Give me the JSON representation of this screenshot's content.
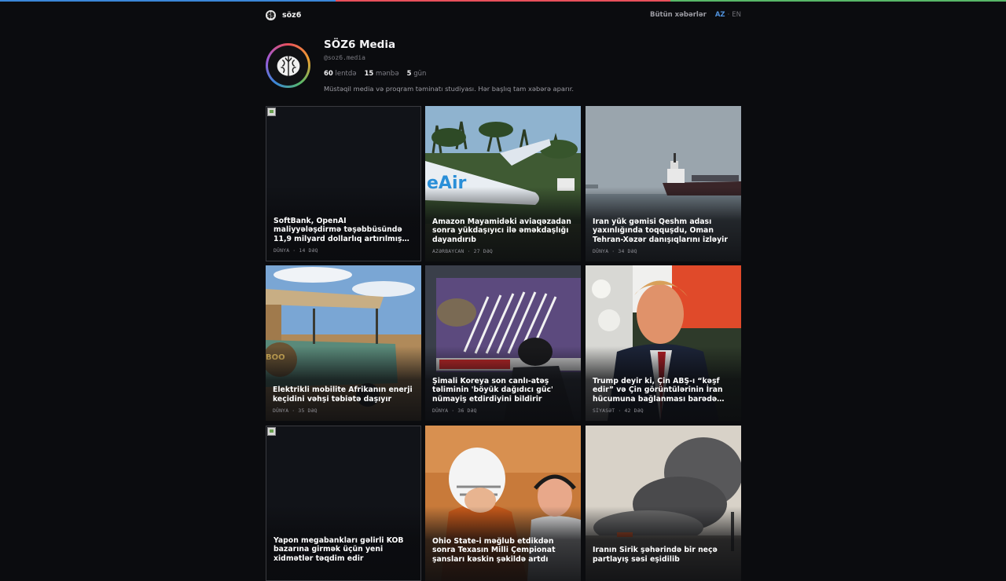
{
  "colors": {
    "top_line": [
      "#3a86d8",
      "#e8505b",
      "#58b868"
    ],
    "lang_active": "#4f8fd8"
  },
  "nav": {
    "brand": "söz6",
    "all_news": "Bütün xəbərlər",
    "lang_az": "AZ",
    "lang_sep": "·",
    "lang_en": "EN"
  },
  "profile": {
    "name": "SÖZ6 Media",
    "handle": "@soz6.media",
    "stats": [
      {
        "value": "60",
        "label": "lentdə"
      },
      {
        "value": "15",
        "label": "mənbə"
      },
      {
        "value": "5",
        "label": "gün"
      }
    ],
    "description": "Müstəqil media və proqram təminatı studiyası. Hər başlıq tam xəbərə aparır."
  },
  "cards": [
    {
      "title": "SoftBank, OpenAI maliyyələşdirmə təşəbbüsündə 11,9 milyard dollarlıq artırılmış kredit alır",
      "category": "DÜNYA",
      "time": "14 DƏQ",
      "image": "broken-image-icon"
    },
    {
      "title": "Amazon Mayamidəki aviaqəzadan sonra yükdaşıyıcı ilə əməkdaşlığı dayandırıb",
      "category": "AZƏRBAYCAN",
      "time": "27 DƏQ",
      "image": "crashed-plane-photo"
    },
    {
      "title": "İran yük gəmisi Qeshm adası yaxınlığında toqquşdu, Oman Tehran-Xəzər danışıqlarını izləyir",
      "category": "DÜNYA",
      "time": "34 DƏQ",
      "image": "cargo-ship-photo"
    },
    {
      "title": "Elektrikli mobilite Afrikanın enerji keçidini vəhşi təbiətə daşıyır",
      "category": "DÜNYA",
      "time": "35 DƏQ",
      "image": "safari-jeep-photo"
    },
    {
      "title": "Şimali Koreya son canlı-atəş təliminin 'böyük dağıdıcı güc' nümayiş etdirdiyini bildirir",
      "category": "DÜNYA",
      "time": "36 DƏQ",
      "image": "tv-missile-launch-photo"
    },
    {
      "title": "Trump deyir ki, Çin ABŞ-ı “kəşf edir” və Çin görüntülərinin İran hücumuna bağlanması barədə iddialar",
      "category": "SİYASƏT",
      "time": "42 DƏQ",
      "image": "trump-portrait-photo"
    },
    {
      "title": "Yapon megabankları gəlirli KOB bazarına girmək üçün yeni xidmətlər təqdim edir",
      "category": "",
      "time": "",
      "image": "broken-image-icon"
    },
    {
      "title": "Ohio State-i məğlub etdikdən sonra Texasın Milli Çempionat şansları kəskin şəkildə artdı",
      "category": "",
      "time": "",
      "image": "football-players-photo"
    },
    {
      "title": "İranın Sirik şəhərində bir neçə partlayış səsi eşidilib",
      "category": "",
      "time": "",
      "image": "smoke-cloud-photo"
    }
  ]
}
